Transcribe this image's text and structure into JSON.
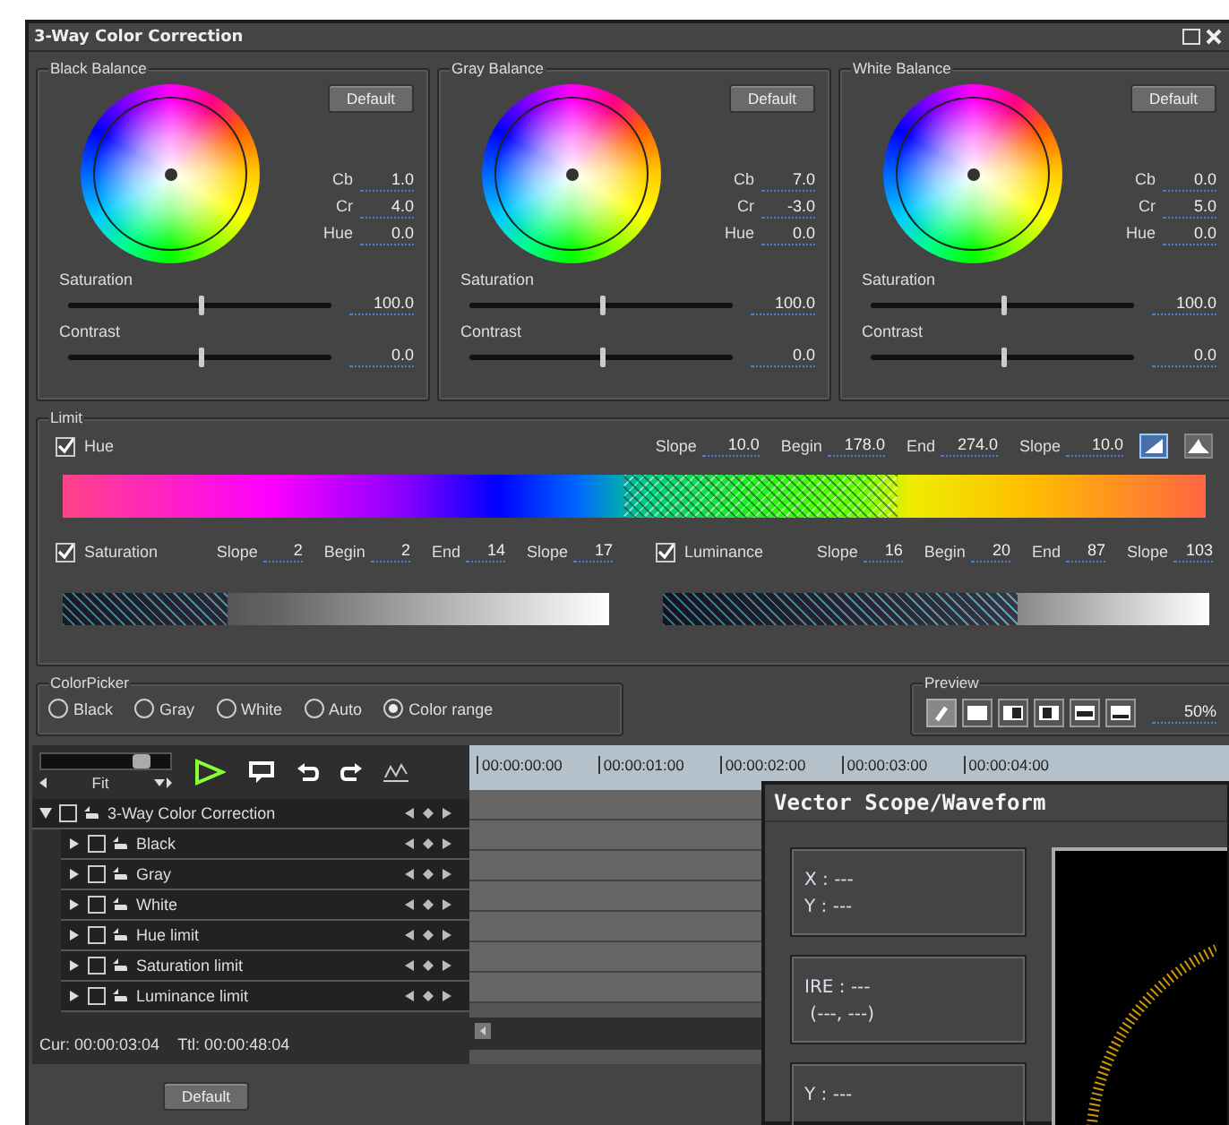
{
  "window": {
    "title": "3-Way Color Correction"
  },
  "balances": [
    {
      "title": "Black Balance",
      "button": "Default",
      "fields": [
        {
          "label": "Cb",
          "value": "1.0"
        },
        {
          "label": "Cr",
          "value": "4.0"
        },
        {
          "label": "Hue",
          "value": "0.0"
        }
      ],
      "sliders": [
        {
          "label": "Saturation",
          "level": 0.5,
          "value": "100.0"
        },
        {
          "label": "Contrast",
          "level": 0.5,
          "value": "0.0"
        }
      ]
    },
    {
      "title": "Gray Balance",
      "button": "Default",
      "fields": [
        {
          "label": "Cb",
          "value": "7.0"
        },
        {
          "label": "Cr",
          "value": "-3.0"
        },
        {
          "label": "Hue",
          "value": "0.0"
        }
      ],
      "sliders": [
        {
          "label": "Saturation",
          "level": 0.5,
          "value": "100.0"
        },
        {
          "label": "Contrast",
          "level": 0.5,
          "value": "0.0"
        }
      ]
    },
    {
      "title": "White Balance",
      "button": "Default",
      "fields": [
        {
          "label": "Cb",
          "value": "0.0"
        },
        {
          "label": "Cr",
          "value": "5.0"
        },
        {
          "label": "Hue",
          "value": "0.0"
        }
      ],
      "sliders": [
        {
          "label": "Saturation",
          "level": 0.5,
          "value": "100.0"
        },
        {
          "label": "Contrast",
          "level": 0.5,
          "value": "0.0"
        }
      ]
    }
  ],
  "limit": {
    "title": "Limit",
    "hue": {
      "label": "Hue",
      "checked": true,
      "params": [
        {
          "label": "Slope",
          "value": "10.0"
        },
        {
          "label": "Begin",
          "value": "178.0"
        },
        {
          "label": "End",
          "value": "274.0"
        },
        {
          "label": "Slope",
          "value": "10.0"
        }
      ]
    },
    "saturation": {
      "label": "Saturation",
      "checked": true,
      "params": [
        {
          "label": "Slope",
          "value": "2"
        },
        {
          "label": "Begin",
          "value": "2"
        },
        {
          "label": "End",
          "value": "14"
        },
        {
          "label": "Slope",
          "value": "17"
        }
      ]
    },
    "luminance": {
      "label": "Luminance",
      "checked": true,
      "params": [
        {
          "label": "Slope",
          "value": "16"
        },
        {
          "label": "Begin",
          "value": "20"
        },
        {
          "label": "End",
          "value": "87"
        },
        {
          "label": "Slope",
          "value": "103"
        }
      ]
    }
  },
  "colorpicker": {
    "title": "ColorPicker",
    "options": [
      {
        "label": "Black",
        "selected": false
      },
      {
        "label": "Gray",
        "selected": false
      },
      {
        "label": "White",
        "selected": false
      },
      {
        "label": "Auto",
        "selected": false
      },
      {
        "label": "Color range",
        "selected": true
      }
    ]
  },
  "preview": {
    "title": "Preview",
    "value": "50%"
  },
  "timeline": {
    "zoom_label": "Fit",
    "zoom_slider": {
      "level": 0.85
    },
    "tracks": [
      {
        "label": "3-Way Color Correction",
        "checked": false,
        "expanded": true,
        "children": [
          {
            "label": "Black",
            "checked": false,
            "expanded": false
          },
          {
            "label": "Gray",
            "checked": false,
            "expanded": false
          },
          {
            "label": "White",
            "checked": false,
            "expanded": false
          },
          {
            "label": "Hue limit",
            "checked": false,
            "expanded": false
          },
          {
            "label": "Saturation limit",
            "checked": false,
            "expanded": false
          },
          {
            "label": "Luminance limit",
            "checked": false,
            "expanded": false
          }
        ]
      }
    ],
    "ruler": [
      "00:00:00:00",
      "00:00:01:00",
      "00:00:02:00",
      "00:00:03:00",
      "00:00:04:00"
    ],
    "current": "Cur: 00:00:03:04",
    "total": "Ttl: 00:00:48:04"
  },
  "default_button": "Default",
  "scope": {
    "title": "Vector Scope/Waveform",
    "readouts": [
      [
        "X : ---",
        "Y : ---"
      ],
      [
        "IRE : ---",
        " (---, ---)"
      ],
      [
        "Y : ---"
      ]
    ]
  }
}
